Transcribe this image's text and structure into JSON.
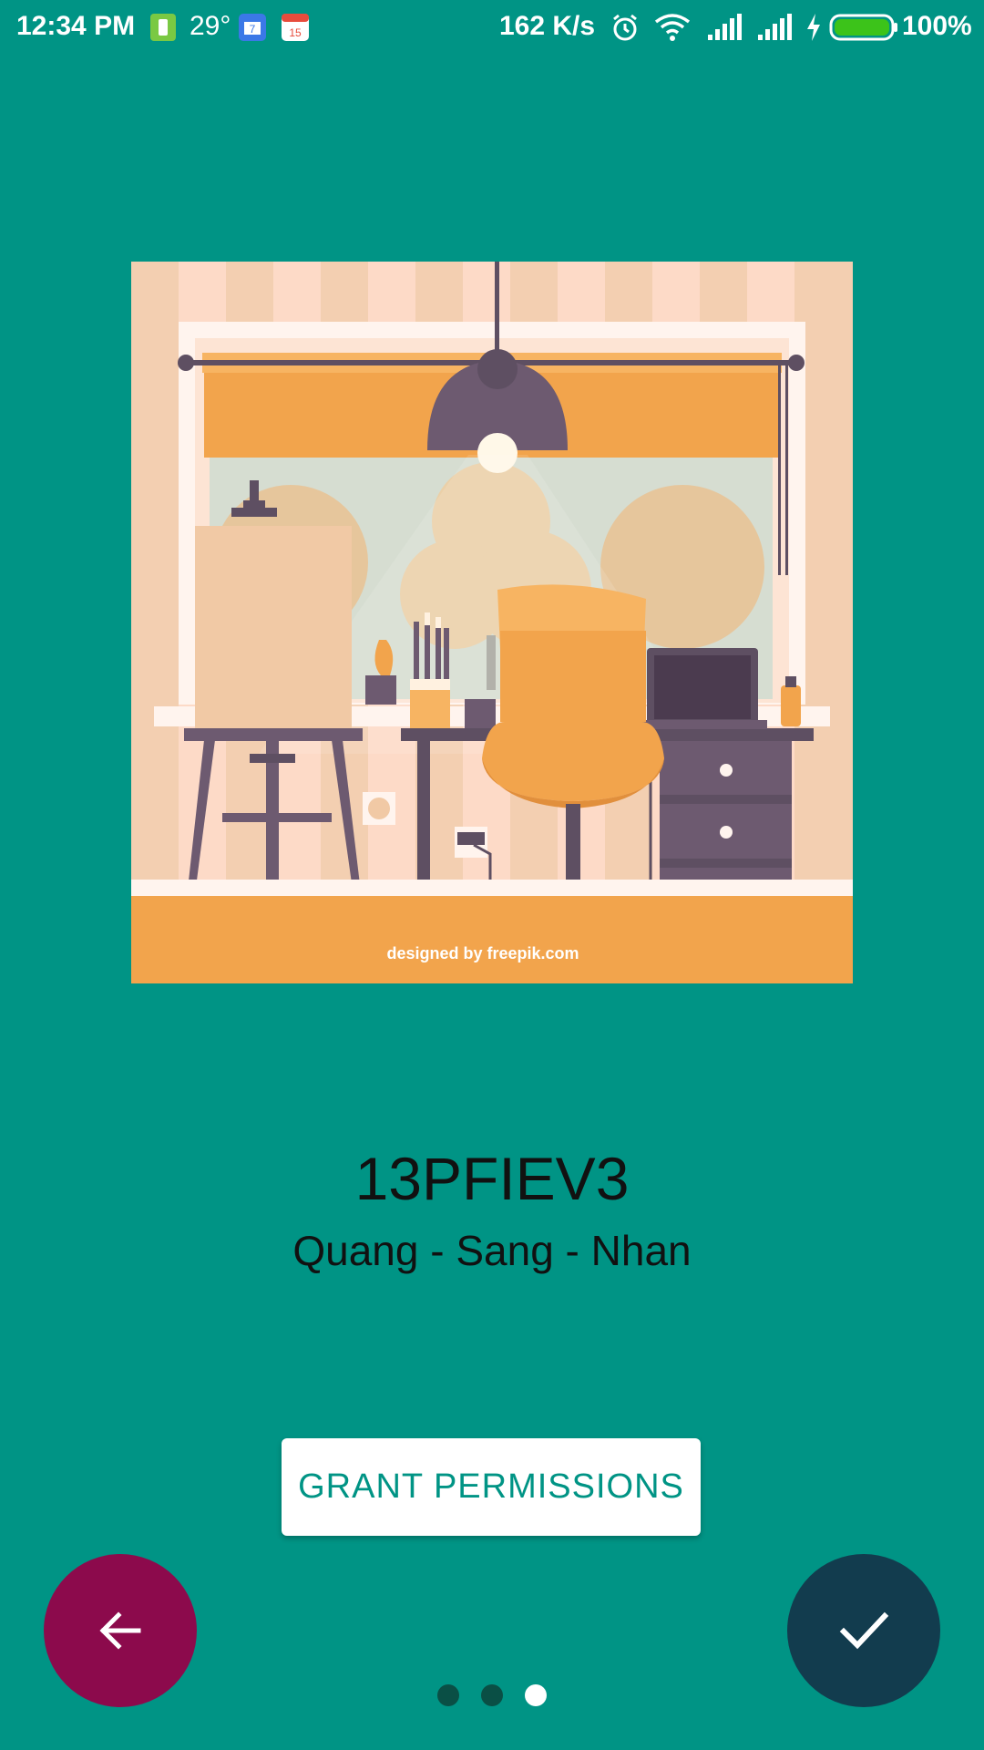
{
  "status_bar": {
    "time": "12:34 PM",
    "temperature": "29°",
    "network_speed": "162 K/s",
    "battery_percent": "100%",
    "icons": [
      "battery-saver-icon",
      "calendar-icon",
      "calendar-15-icon",
      "alarm-icon",
      "wifi-icon",
      "signal-icon",
      "signal-icon",
      "charging-icon",
      "battery-icon"
    ]
  },
  "illustration": {
    "description_icon": "art-studio-illustration",
    "credit_text": "designed by freepik.com"
  },
  "intro": {
    "title": "13PFIEV3",
    "subtitle": "Quang - Sang - Nhan"
  },
  "actions": {
    "grant_label": "GRANT PERMISSIONS",
    "back_icon": "arrow-left-icon",
    "done_icon": "check-icon"
  },
  "pager": {
    "total": 3,
    "active_index": 2
  },
  "colors": {
    "background": "#009485",
    "back_fab": "#8c0a4c",
    "done_fab": "#123c4e",
    "grant_text": "#009485",
    "dot_inactive": "#0a4f45",
    "dot_active": "#ffffff"
  }
}
